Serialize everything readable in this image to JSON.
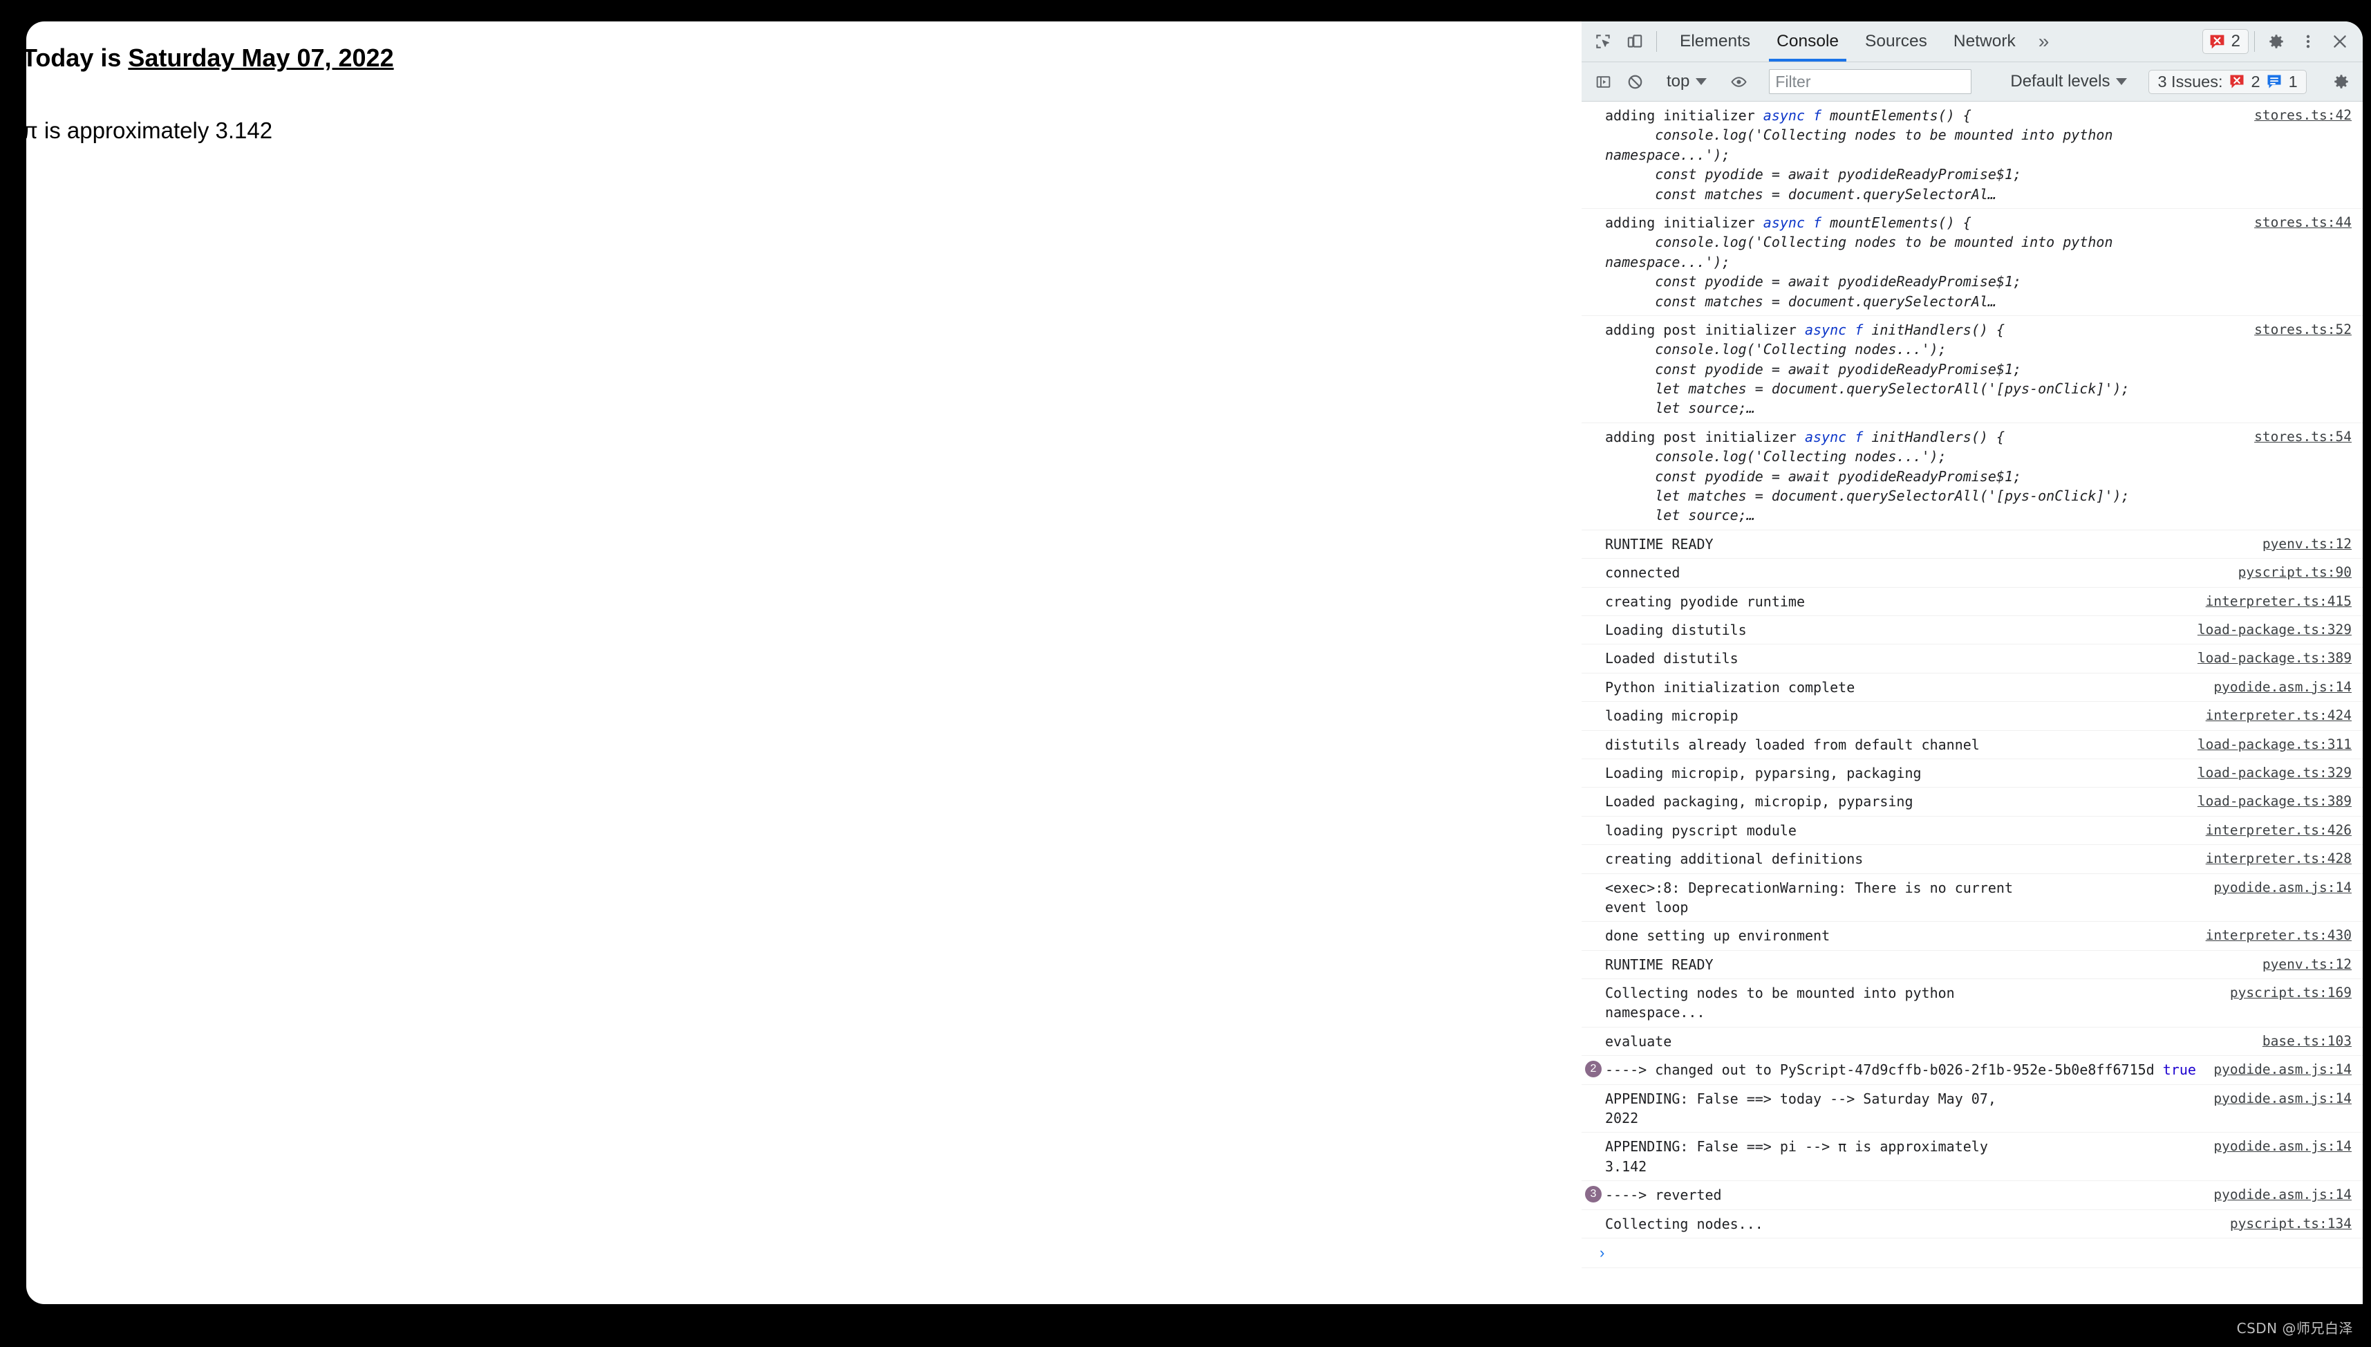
{
  "page": {
    "line1_prefix": "Today is ",
    "line1_date": "Saturday May 07, 2022",
    "line2": "π is approximately 3.142"
  },
  "devtools": {
    "tabs": [
      {
        "label": "Elements",
        "active": false
      },
      {
        "label": "Console",
        "active": true
      },
      {
        "label": "Sources",
        "active": false
      },
      {
        "label": "Network",
        "active": false
      }
    ],
    "more_tabs_icon": "»",
    "icons": {
      "inspect": "inspect-element-icon",
      "device": "device-toolbar-icon",
      "settings": "gear-icon",
      "kebab": "kebab-menu-icon",
      "close": "close-icon",
      "sidebar": "console-sidebar-icon",
      "clear": "clear-console-icon",
      "eye": "live-expression-icon",
      "console_settings": "console-settings-gear-icon"
    },
    "error_chip": {
      "count": "2"
    },
    "toolbar": {
      "context": "top",
      "filter_placeholder": "Filter",
      "filter_value": "",
      "levels": "Default levels",
      "issues_label": "3 Issues:",
      "issues_errors": "2",
      "issues_info": "1"
    },
    "colors": {
      "accent": "#1a73e8",
      "error_red": "#e13030",
      "info_blue": "#1a73e8",
      "toolbar_bg": "#e9eef0",
      "badge_purple": "#8a6a8a"
    },
    "prompt": "›",
    "logs": [
      {
        "type": "code",
        "head_pre": "adding initializer ",
        "head_kw": "async f",
        "head_post": " mountElements() {",
        "body": "      console.log('Collecting nodes to be mounted into python\nnamespace...');\n      const pyodide = await pyodideReadyPromise$1;\n      const matches = document.querySelectorAl…",
        "src": "stores.ts:42"
      },
      {
        "type": "code",
        "head_pre": "adding initializer ",
        "head_kw": "async f",
        "head_post": " mountElements() {",
        "body": "      console.log('Collecting nodes to be mounted into python\nnamespace...');\n      const pyodide = await pyodideReadyPromise$1;\n      const matches = document.querySelectorAl…",
        "src": "stores.ts:44"
      },
      {
        "type": "code",
        "head_pre": "adding post initializer ",
        "head_kw": "async f",
        "head_post": " initHandlers() {",
        "body": "      console.log('Collecting nodes...');\n      const pyodide = await pyodideReadyPromise$1;\n      let matches = document.querySelectorAll('[pys-onClick]');\n      let source;…",
        "src": "stores.ts:52"
      },
      {
        "type": "code",
        "head_pre": "adding post initializer ",
        "head_kw": "async f",
        "head_post": " initHandlers() {",
        "body": "      console.log('Collecting nodes...');\n      const pyodide = await pyodideReadyPromise$1;\n      let matches = document.querySelectorAll('[pys-onClick]');\n      let source;…",
        "src": "stores.ts:54"
      },
      {
        "type": "text",
        "msg": "RUNTIME READY",
        "src": "pyenv.ts:12"
      },
      {
        "type": "text",
        "msg": "connected",
        "src": "pyscript.ts:90"
      },
      {
        "type": "text",
        "msg": "creating pyodide runtime",
        "src": "interpreter.ts:415"
      },
      {
        "type": "text",
        "msg": "Loading distutils",
        "src": "load-package.ts:329"
      },
      {
        "type": "text",
        "msg": "Loaded distutils",
        "src": "load-package.ts:389"
      },
      {
        "type": "text",
        "msg": "Python initialization complete",
        "src": "pyodide.asm.js:14"
      },
      {
        "type": "text",
        "msg": "loading micropip",
        "src": "interpreter.ts:424"
      },
      {
        "type": "text",
        "msg": "distutils already loaded from default channel",
        "src": "load-package.ts:311"
      },
      {
        "type": "text",
        "msg": "Loading micropip, pyparsing, packaging",
        "src": "load-package.ts:329"
      },
      {
        "type": "text",
        "msg": "Loaded packaging, micropip, pyparsing",
        "src": "load-package.ts:389"
      },
      {
        "type": "text",
        "msg": "loading pyscript module",
        "src": "interpreter.ts:426"
      },
      {
        "type": "text",
        "msg": "creating additional definitions",
        "src": "interpreter.ts:428"
      },
      {
        "type": "text",
        "msg": "<exec>:8: DeprecationWarning: There is no current\nevent loop",
        "src": "pyodide.asm.js:14"
      },
      {
        "type": "text",
        "msg": "done setting up environment",
        "src": "interpreter.ts:430"
      },
      {
        "type": "text",
        "msg": "RUNTIME READY",
        "src": "pyenv.ts:12"
      },
      {
        "type": "text",
        "msg": "Collecting nodes to be mounted into python\nnamespace...",
        "src": "pyscript.ts:169"
      },
      {
        "type": "text",
        "msg": "evaluate",
        "src": "base.ts:103"
      },
      {
        "type": "bool",
        "count": "2",
        "msg": "----> changed out to PyScript-47d9cffb-b026-2f1b-952e-5b0e8ff6715d ",
        "bool_value": "true",
        "src": "pyodide.asm.js:14"
      },
      {
        "type": "text",
        "msg": "APPENDING: False ==> today --> Saturday May 07,\n2022",
        "src": "pyodide.asm.js:14"
      },
      {
        "type": "text",
        "msg": "APPENDING: False ==> pi --> π is approximately\n3.142",
        "src": "pyodide.asm.js:14"
      },
      {
        "type": "text",
        "count": "3",
        "msg": "----> reverted",
        "src": "pyodide.asm.js:14"
      },
      {
        "type": "text",
        "msg": "Collecting nodes...",
        "src": "pyscript.ts:134"
      }
    ]
  },
  "watermark": "CSDN @师兄白泽"
}
